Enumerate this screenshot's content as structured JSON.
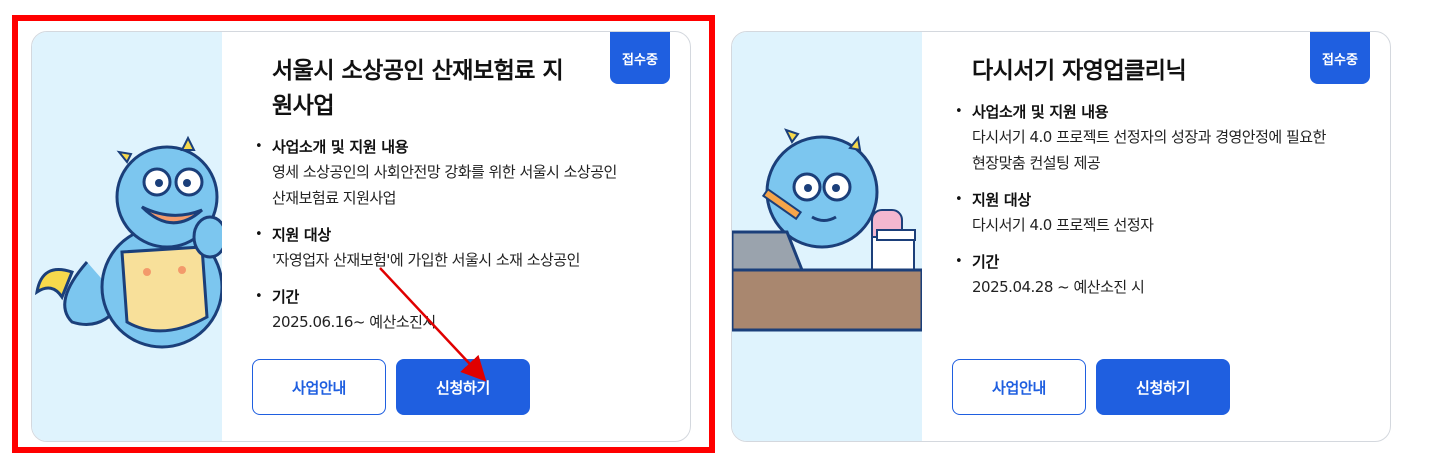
{
  "cards": [
    {
      "badge": "접수중",
      "title": "서울시 소상공인 산재보험료 지원사업",
      "sections": [
        {
          "heading": "사업소개 및 지원 내용",
          "lines": [
            "영세 소상공인의 사회안전망 강화를 위한 서울시 소상공인",
            "산재보험료 지원사업"
          ]
        },
        {
          "heading": "지원 대상",
          "lines": [
            "'자영업자 산재보험'에 가입한 서울시 소재 소상공인"
          ]
        },
        {
          "heading": "기간",
          "lines": [
            "2025.06.16~ 예산소진시"
          ]
        }
      ],
      "buttons": {
        "info": "사업안내",
        "apply": "신청하기"
      }
    },
    {
      "badge": "접수중",
      "title": "다시서기 자영업클리닉",
      "sections": [
        {
          "heading": "사업소개 및 지원 내용",
          "lines": [
            "다시서기 4.0 프로젝트 선정자의 성장과 경영안정에 필요한",
            "현장맞춤 컨설팅 제공"
          ]
        },
        {
          "heading": "지원 대상",
          "lines": [
            "다시서기 4.0 프로젝트 선정자"
          ]
        },
        {
          "heading": "기간",
          "lines": [
            "2025.04.28 ~ 예산소진 시"
          ]
        }
      ],
      "buttons": {
        "info": "사업안내",
        "apply": "신청하기"
      }
    }
  ],
  "colors": {
    "primary": "#1f5fe0",
    "illustration_bg": "#dff3fd",
    "highlight": "#ff0000"
  }
}
